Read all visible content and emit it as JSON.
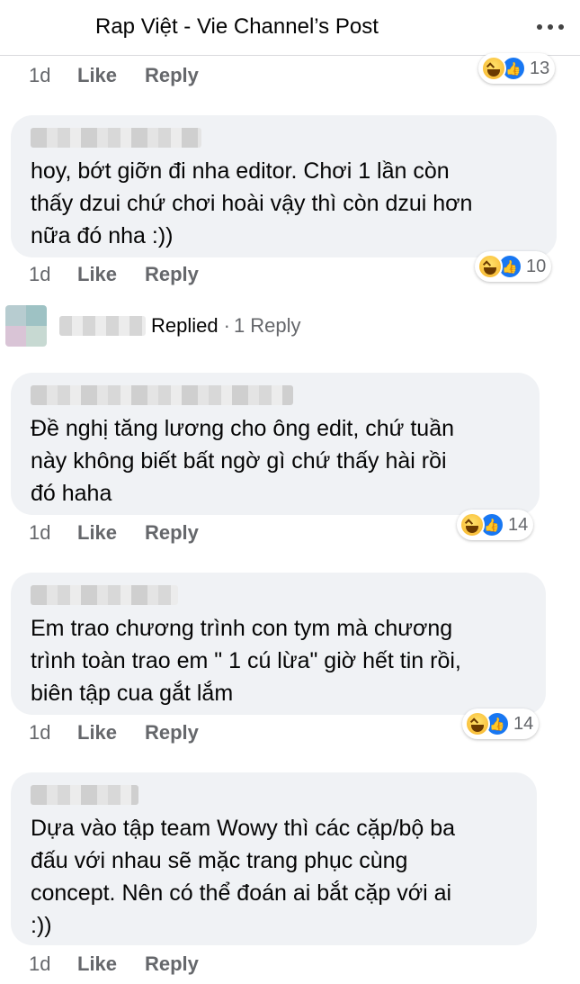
{
  "header": {
    "title": "Rap Việt - Vie Channel’s Post"
  },
  "top_actions": {
    "time": "1d",
    "like": "Like",
    "reply": "Reply",
    "reaction_count": "13"
  },
  "comments": [
    {
      "text": "hoy, bớt giỡn đi nha editor. Chơi 1 lần còn\nthấy dzui chứ chơi hoài vậy thì còn dzui hơn\nnữa đó nha :))",
      "time": "1d",
      "like": "Like",
      "reply": "Reply",
      "reaction_count": "10"
    },
    {
      "text": "Đề nghị tăng lương cho ông edit, chứ tuần\nnày không biết bất ngờ gì chứ thấy hài rồi\nđó haha",
      "time": "1d",
      "like": "Like",
      "reply": "Reply",
      "reaction_count": "14"
    },
    {
      "text": "Em trao chương trình con tym mà chương\ntrình toàn trao em \" 1 cú lừa\" giờ hết tin rồi,\nbiên tập cua gắt lắm",
      "time": "1d",
      "like": "Like",
      "reply": "Reply",
      "reaction_count": "14"
    },
    {
      "text": "Dựa vào tập team Wowy thì các cặp/bộ ba\nđấu với nhau sẽ mặc trang phục cùng\nconcept. Nên có thể đoán ai bắt cặp với ai\n:))",
      "time": "1d",
      "like": "Like",
      "reply": "Reply"
    }
  ],
  "replied": {
    "label": "Replied",
    "separator": "·",
    "count": "1 Reply"
  },
  "icons": {
    "more": "more-horizontal-icon",
    "haha": "haha-reaction-icon",
    "like": "like-reaction-icon"
  },
  "colors": {
    "bubble": "#f0f2f5",
    "muted": "#65676b",
    "like_blue": "#1877f2"
  }
}
